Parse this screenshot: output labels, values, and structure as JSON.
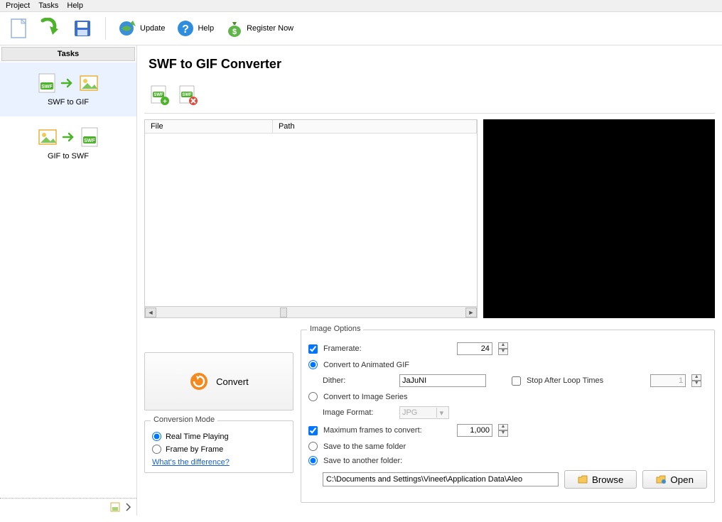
{
  "menu": {
    "project": "Project",
    "tasks": "Tasks",
    "help": "Help"
  },
  "toolbar": {
    "update": "Update",
    "help": "Help",
    "register": "Register Now"
  },
  "sidebar": {
    "header": "Tasks",
    "items": [
      {
        "label": "SWF to GIF"
      },
      {
        "label": "GIF to SWF"
      }
    ]
  },
  "main": {
    "title": "SWF to GIF Converter",
    "columns": {
      "file": "File",
      "path": "Path"
    }
  },
  "convert": {
    "label": "Convert"
  },
  "mode": {
    "legend": "Conversion Mode",
    "realtime": "Real Time Playing",
    "framebyframe": "Frame by Frame",
    "difflink": "What's the difference?"
  },
  "opts": {
    "legend": "Image Options",
    "framerate_label": "Framerate:",
    "framerate_value": "24",
    "convert_animated": "Convert to Animated GIF",
    "dither_label": "Dither:",
    "dither_value": "JaJuNI",
    "stoploop_label": "Stop After Loop Times",
    "stoploop_value": "1",
    "convert_series": "Convert to Image Series",
    "image_format_label": "Image Format:",
    "image_format_value": "JPG",
    "maxframes_label": "Maximum frames to convert:",
    "maxframes_value": "1,000",
    "save_same": "Save to the same folder",
    "save_another": "Save to another folder:",
    "path_value": "C:\\Documents and Settings\\Vineet\\Application Data\\Aleo",
    "browse": "Browse",
    "open": "Open"
  }
}
